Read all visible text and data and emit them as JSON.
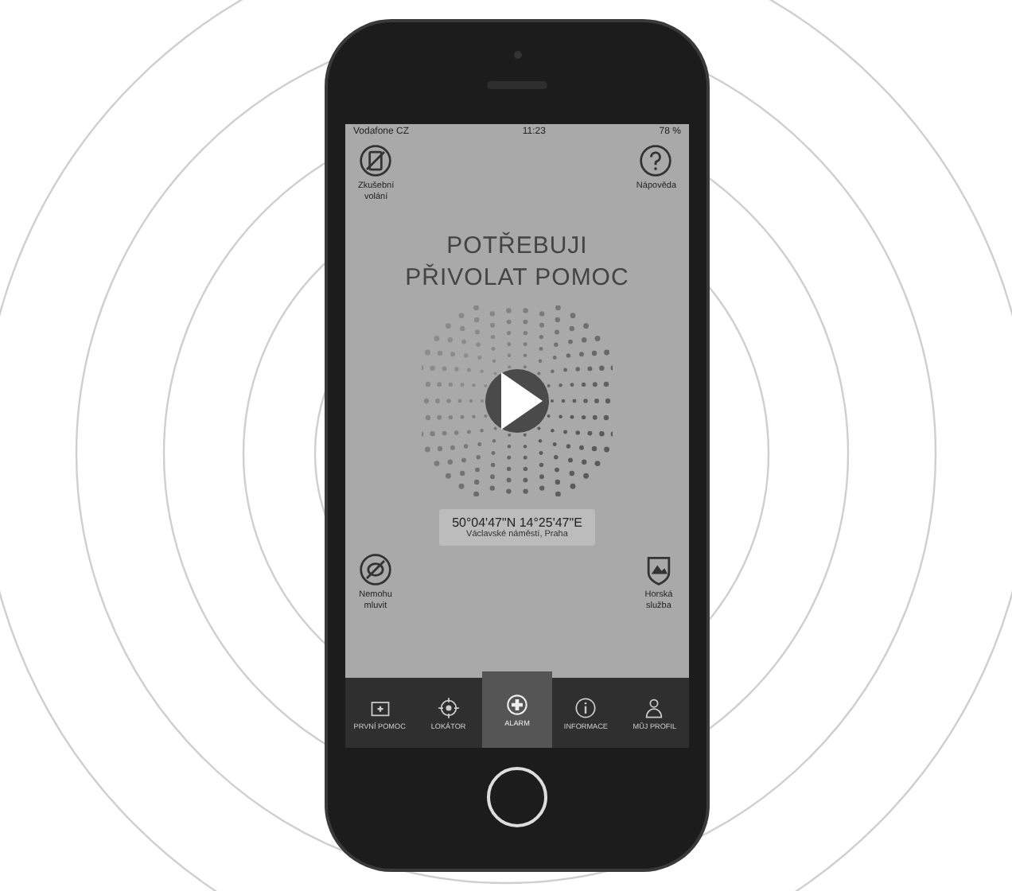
{
  "status_bar": {
    "carrier": "Vodafone CZ",
    "time": "11:23",
    "battery": "78 %"
  },
  "top_actions": [
    {
      "label": "Zkušební\nvolání",
      "kind": "test"
    },
    {
      "label": "Nápověda",
      "kind": "help"
    }
  ],
  "headline": "POTŘEBUJI\nPŘIVOLAT POMOC",
  "location": {
    "coordinates": "50°04'47\"N 14°25'47\"E",
    "address": "Václavské náměstí, Praha"
  },
  "bottom_actions": [
    {
      "label": "Nemohu\nmluvit",
      "kind": "mute"
    },
    {
      "label": "Horská\nslužba",
      "kind": "mountain"
    }
  ],
  "tabs": [
    {
      "label": "PRVNÍ POMOC",
      "kind": "kit",
      "selected": false
    },
    {
      "label": "LOKÁTOR",
      "kind": "target",
      "selected": false
    },
    {
      "label": "ALARM",
      "kind": "plus",
      "selected": true
    },
    {
      "label": "INFORMACE",
      "kind": "info",
      "selected": false
    },
    {
      "label": "MŮJ PROFIL",
      "kind": "person",
      "selected": false
    }
  ]
}
